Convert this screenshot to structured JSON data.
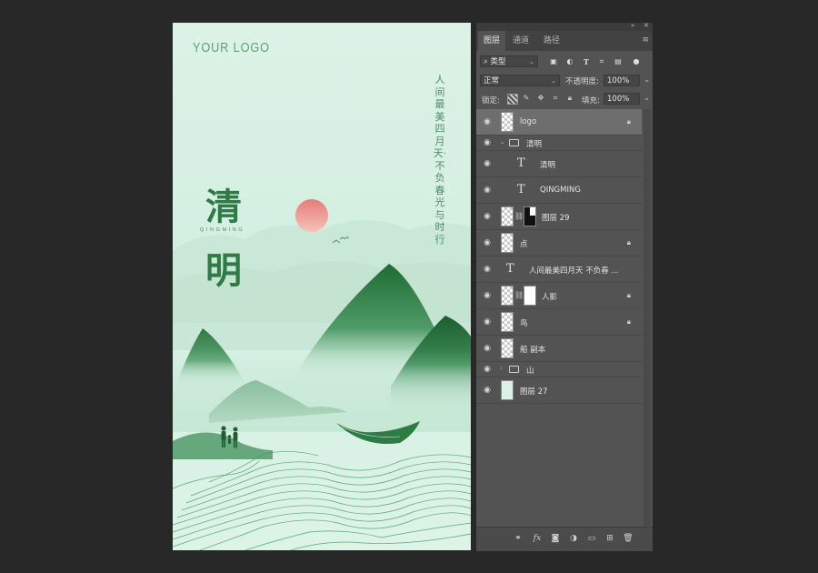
{
  "poster": {
    "logo": "YOUR LOGO",
    "vertical_text": "人间最美四月天·不负春光与时行",
    "title_char_1": "清",
    "title_char_2": "明",
    "pinyin": "QINGMING",
    "colors": {
      "background": "#d8f0e3",
      "mountain": "#2e7d43",
      "sun": "#e98a86",
      "lines": "#3f9a5c"
    }
  },
  "panel": {
    "tabs": [
      "图层",
      "通道",
      "路径"
    ],
    "filter_kind": "类型",
    "blend_mode": "正常",
    "opacity_label": "不透明度:",
    "opacity_value": "100%",
    "lock_label": "锁定:",
    "fill_label": "填充:",
    "fill_value": "100%",
    "layers": [
      {
        "name": "logo",
        "type": "pixel",
        "locked": true,
        "selected": true
      },
      {
        "name": "清明",
        "type": "group",
        "expanded": true
      },
      {
        "name": "清明",
        "type": "text"
      },
      {
        "name": "QINGMING",
        "type": "text"
      },
      {
        "name": "图层 29",
        "type": "pixel-with-mask"
      },
      {
        "name": "点",
        "type": "pixel",
        "locked": true
      },
      {
        "name": "人间最美四月天  不负春 ...",
        "type": "text"
      },
      {
        "name": "人影",
        "type": "pixel-with-mask",
        "locked": true
      },
      {
        "name": "鸟",
        "type": "pixel",
        "locked": true
      },
      {
        "name": "船 副本",
        "type": "pixel"
      },
      {
        "name": "山",
        "type": "group",
        "expanded": false
      },
      {
        "name": "图层 27",
        "type": "fill"
      }
    ],
    "bottom_icons": [
      "link-icon",
      "fx-icon",
      "mask-icon",
      "adjustment-icon",
      "new-group-icon",
      "new-layer-icon",
      "trash-icon"
    ]
  }
}
